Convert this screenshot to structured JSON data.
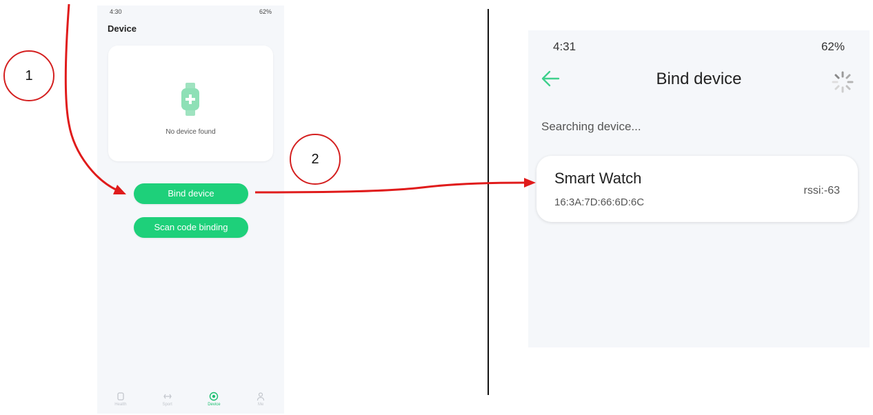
{
  "left_screen": {
    "status_time": "4:30",
    "status_right": "62%",
    "title": "Device",
    "empty_text": "No device found",
    "bind_button": "Bind device",
    "scan_button": "Scan code binding",
    "tabs": [
      {
        "label": "Health",
        "icon": "watch-icon"
      },
      {
        "label": "Sport",
        "icon": "sport-icon"
      },
      {
        "label": "Device",
        "icon": "device-icon",
        "active": true
      },
      {
        "label": "Me",
        "icon": "person-icon"
      }
    ]
  },
  "right_screen": {
    "status_time": "4:31",
    "status_right": "62%",
    "title": "Bind device",
    "searching": "Searching device...",
    "device": {
      "name": "Smart Watch",
      "mac": "16:3A:7D:66:6D:6C",
      "rssi": "rssi:-63"
    }
  },
  "annotations": {
    "step1": "1",
    "step2": "2"
  },
  "colors": {
    "accent": "#1ed07a",
    "arrow": "#e01b1b",
    "back_arrow": "#3fd08c"
  }
}
